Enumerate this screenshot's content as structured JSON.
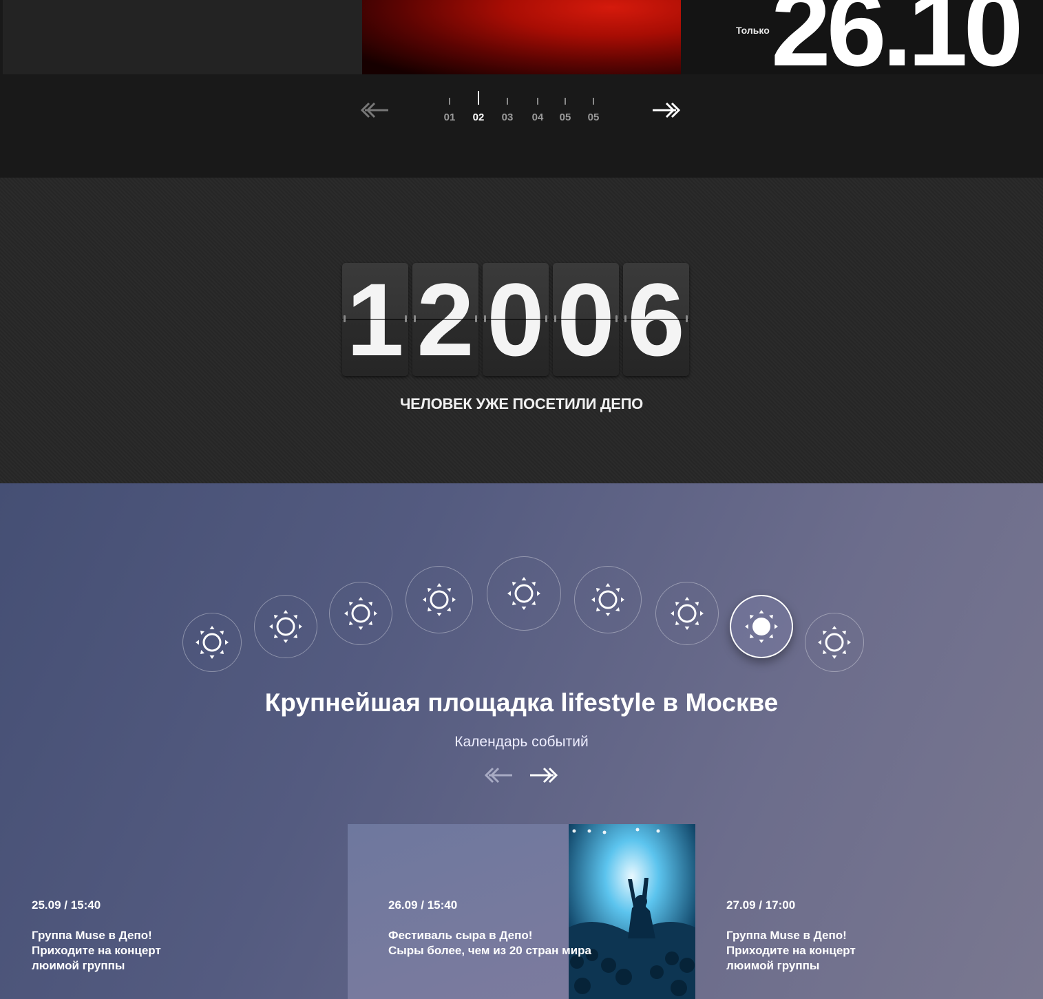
{
  "top_slider": {
    "only_label": "Только",
    "date": "26.10",
    "prev_icon": "double-arrow-left-icon",
    "next_icon": "double-arrow-right-icon",
    "pages": [
      "01",
      "02",
      "03",
      "04",
      "05",
      "05"
    ],
    "active_page_index": 1
  },
  "counter": {
    "digits": [
      "1",
      "2",
      "0",
      "0",
      "6"
    ],
    "caption": "ЧЕЛОВЕК УЖЕ ПОСЕТИЛИ ДЕПО"
  },
  "lifestyle": {
    "weather_icon": "sun-icon",
    "icon_count": 9,
    "active_icon_index": 7,
    "title": "Крупнейшая площадка lifestyle в Москве",
    "subtitle": "Календарь событий",
    "prev_icon": "double-arrow-left-icon",
    "next_icon": "double-arrow-right-icon",
    "events": [
      {
        "date": "25.09 / 15:40",
        "lines": [
          "Группа Muse в Депо!",
          "Приходите на концерт",
          "люимой группы"
        ]
      },
      {
        "date": "26.09 / 15:40",
        "lines": [
          "Фестиваль сыра в Депо!",
          "Сыры более, чем из 20 стран мира"
        ]
      },
      {
        "date": "27.09  / 17:00",
        "lines": [
          "Группа Muse в Депо!",
          "Приходите на концерт",
          "люимой группы"
        ]
      }
    ]
  },
  "colors": {
    "accent_red": "#a80d04",
    "dark_bg": "#191919",
    "lifestyle_bg": "#545b80"
  }
}
